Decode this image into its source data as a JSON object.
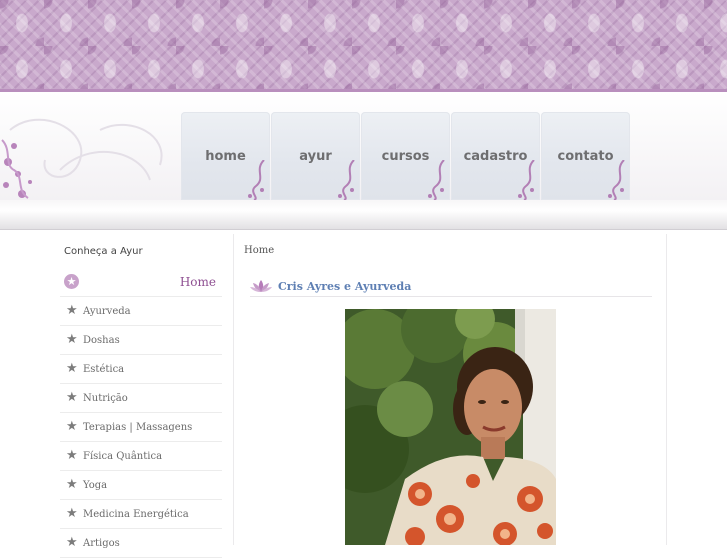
{
  "nav": {
    "tabs": [
      {
        "label": "home"
      },
      {
        "label": "ayur"
      },
      {
        "label": "cursos"
      },
      {
        "label": "cadastro"
      },
      {
        "label": "contato"
      }
    ]
  },
  "sidebar": {
    "title": "Conheça a Ayur",
    "items": [
      {
        "label": "Home"
      },
      {
        "label": "Ayurveda"
      },
      {
        "label": "Doshas"
      },
      {
        "label": "Estética"
      },
      {
        "label": "Nutrição"
      },
      {
        "label": "Terapias | Massagens"
      },
      {
        "label": "Física Quântica"
      },
      {
        "label": "Yoga"
      },
      {
        "label": "Medicina Energética"
      },
      {
        "label": "Artigos"
      }
    ]
  },
  "content": {
    "breadcrumb": "Home",
    "title": "Cris Ayres e Ayurveda"
  },
  "colors": {
    "accent": "#8e4f91",
    "banner": "#c9a9cc",
    "title_blue": "#5e7fb3"
  },
  "icons": {
    "menu_item": "star-icon",
    "title": "lotus-icon"
  }
}
